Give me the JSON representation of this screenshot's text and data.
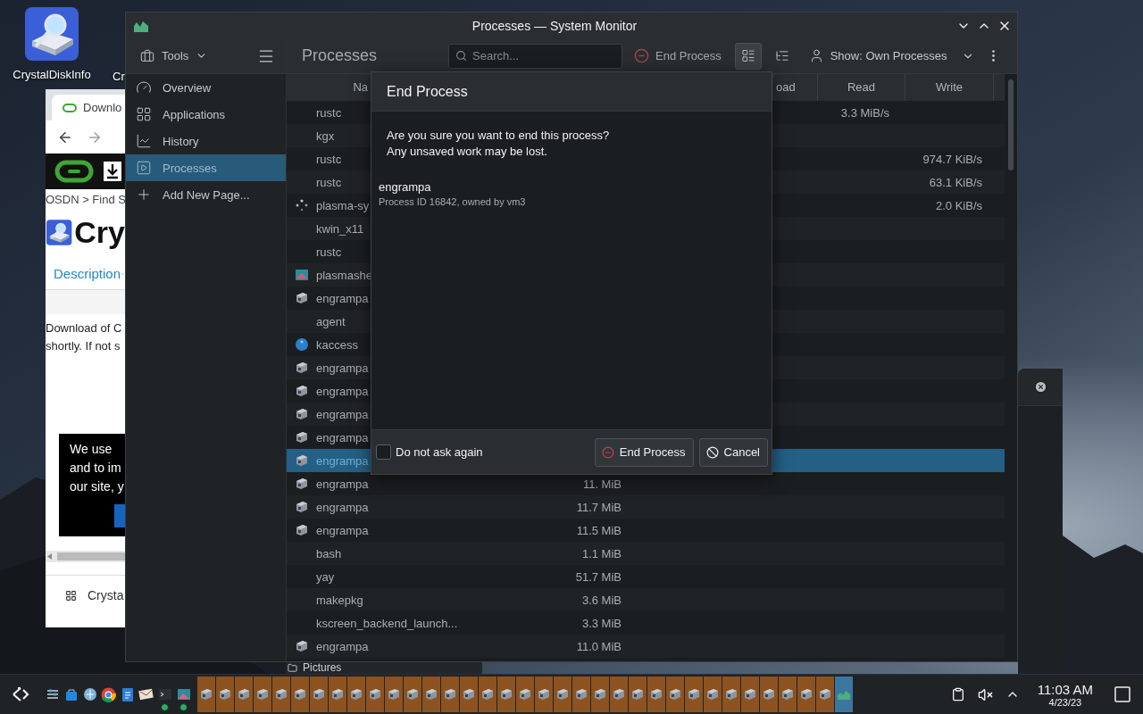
{
  "desktop": {
    "icons": [
      {
        "label": "CrystalDiskInfo"
      },
      {
        "label": "Cr"
      }
    ]
  },
  "browser": {
    "tab": "Downlo",
    "breadcrumb": "OSDN > Find S",
    "heading": "Cry",
    "link": "Description",
    "paragraph": [
      "Download of C",
      "shortly. If not s"
    ],
    "cookie_notice": [
      "We use",
      "and to im",
      "our site, y"
    ],
    "download_item": "Crysta"
  },
  "window": {
    "title": "Processes — System Monitor",
    "sidebar": {
      "tools": "Tools",
      "items": [
        {
          "label": "Overview",
          "kind": "overview",
          "selected": false
        },
        {
          "label": "Applications",
          "kind": "applications",
          "selected": false
        },
        {
          "label": "History",
          "kind": "history",
          "selected": false
        },
        {
          "label": "Processes",
          "kind": "processes",
          "selected": true
        },
        {
          "label": "Add New Page...",
          "kind": "add",
          "selected": false
        }
      ]
    },
    "toolbar": {
      "page_title": "Processes",
      "search": {
        "placeholder": "Search..."
      },
      "end_process": "End Process",
      "view_buttons": [
        {
          "kind": "list",
          "selected": true
        },
        {
          "kind": "tree",
          "selected": false
        }
      ],
      "show_filter": "Show: Own Processes"
    },
    "table": {
      "columns": [
        "Na",
        "oad",
        "Read",
        "Write"
      ],
      "rows": [
        {
          "name": "rustc",
          "kind": "plain",
          "read": "3.3 MiB/s",
          "selected": false
        },
        {
          "name": "kgx",
          "kind": "plain",
          "selected": false
        },
        {
          "name": "rustc",
          "kind": "plain",
          "write": "974.7 KiB/s",
          "selected": false
        },
        {
          "name": "rustc",
          "kind": "plain",
          "write": "63.1 KiB/s",
          "selected": false
        },
        {
          "name": "plasma-sy",
          "kind": "spinner",
          "write": "2.0 KiB/s",
          "selected": false
        },
        {
          "name": "kwin_x11",
          "kind": "plain",
          "selected": false
        },
        {
          "name": "rustc",
          "kind": "plain",
          "selected": false
        },
        {
          "name": "plasmashe",
          "kind": "plasma",
          "selected": false
        },
        {
          "name": "engrampa",
          "kind": "archive",
          "selected": false
        },
        {
          "name": "agent",
          "kind": "plain",
          "selected": false
        },
        {
          "name": "kaccess",
          "kind": "kaccess",
          "selected": false
        },
        {
          "name": "engrampa",
          "kind": "archive",
          "selected": false
        },
        {
          "name": "engrampa",
          "kind": "archive",
          "selected": false
        },
        {
          "name": "engrampa",
          "kind": "archive",
          "selected": false
        },
        {
          "name": "engrampa",
          "kind": "archive",
          "selected": false
        },
        {
          "name": "engrampa",
          "kind": "archive",
          "selected": true
        },
        {
          "name": "engrampa",
          "kind": "archive",
          "memory": "11. MiB",
          "selected": false
        },
        {
          "name": "engrampa",
          "kind": "archive",
          "memory": "11.7 MiB",
          "selected": false
        },
        {
          "name": "engrampa",
          "kind": "archive",
          "memory": "11.5 MiB",
          "selected": false
        },
        {
          "name": "bash",
          "kind": "plain",
          "memory": "1.1 MiB",
          "selected": false
        },
        {
          "name": "yay",
          "kind": "plain",
          "memory": "51.7 MiB",
          "selected": false
        },
        {
          "name": "makepkg",
          "kind": "plain",
          "memory": "3.6 MiB",
          "selected": false
        },
        {
          "name": "kscreen_backend_launch...",
          "kind": "plain",
          "memory": "3.3 MiB",
          "selected": false
        },
        {
          "name": "engrampa",
          "kind": "archive",
          "memory": "11.0 MiB",
          "selected": false
        }
      ]
    },
    "dialog": {
      "title": "End Process",
      "message": [
        "Are you sure you want to end this process?",
        "Any unsaved work may be lost."
      ],
      "process_name": "engrampa",
      "process_info": "Process ID 16842, owned by vm3",
      "dont_ask": {
        "label": "Do not ask again",
        "checked": false
      },
      "buttons": [
        {
          "label": "End Process",
          "kind": "end"
        },
        {
          "label": "Cancel",
          "kind": "cancel"
        }
      ]
    }
  },
  "other_window": {
    "item": "Pictures"
  },
  "taskbar": {
    "tasks": [
      {
        "kind": "archive",
        "selected": false
      },
      {
        "kind": "archive",
        "selected": false
      },
      {
        "kind": "archive",
        "selected": false
      },
      {
        "kind": "archive",
        "selected": false
      },
      {
        "kind": "archive",
        "selected": false
      },
      {
        "kind": "archive",
        "selected": false
      },
      {
        "kind": "archive",
        "selected": false
      },
      {
        "kind": "archive",
        "selected": false
      },
      {
        "kind": "archive",
        "selected": false
      },
      {
        "kind": "archive",
        "selected": false
      },
      {
        "kind": "archive",
        "selected": false
      },
      {
        "kind": "archive",
        "selected": false
      },
      {
        "kind": "archive",
        "selected": false
      },
      {
        "kind": "archive",
        "selected": false
      },
      {
        "kind": "archive",
        "selected": false
      },
      {
        "kind": "archive",
        "selected": false
      },
      {
        "kind": "archive",
        "selected": false
      },
      {
        "kind": "archive",
        "selected": false
      },
      {
        "kind": "archive",
        "selected": false
      },
      {
        "kind": "archive",
        "selected": false
      },
      {
        "kind": "archive",
        "selected": false
      },
      {
        "kind": "archive",
        "selected": false
      },
      {
        "kind": "archive",
        "selected": false
      },
      {
        "kind": "archive",
        "selected": false
      },
      {
        "kind": "archive",
        "selected": false
      },
      {
        "kind": "archive",
        "selected": false
      },
      {
        "kind": "archive",
        "selected": false
      },
      {
        "kind": "archive",
        "selected": false
      },
      {
        "kind": "archive",
        "selected": false
      },
      {
        "kind": "archive",
        "selected": false
      },
      {
        "kind": "archive",
        "selected": false
      },
      {
        "kind": "archive",
        "selected": false
      },
      {
        "kind": "archive",
        "selected": false
      },
      {
        "kind": "archive",
        "selected": false
      },
      {
        "kind": "monitor",
        "selected": true
      }
    ],
    "clock": {
      "time": "11:03 AM",
      "date": "4/23/23"
    }
  }
}
